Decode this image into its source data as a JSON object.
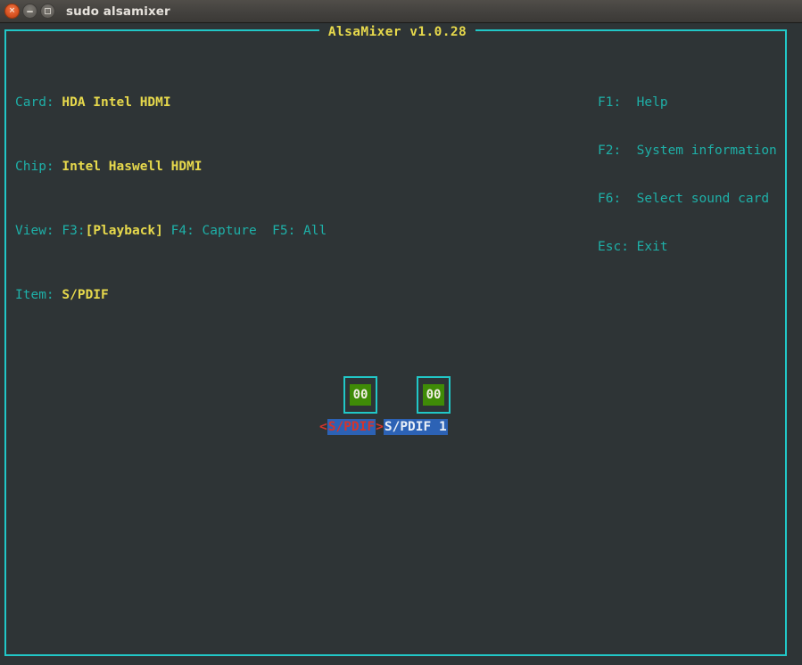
{
  "window": {
    "title": "sudo alsamixer",
    "buttons": {
      "close": "×",
      "minimize": "",
      "maximize": ""
    }
  },
  "app": {
    "frame_title": "AlsaMixer v1.0.28"
  },
  "header": {
    "card_label": "Card:",
    "card_value": "HDA Intel HDMI",
    "chip_label": "Chip:",
    "chip_value": "Intel Haswell HDMI",
    "view_label": "View:",
    "view_f3_key": "F3:",
    "view_f3_value": "[Playback]",
    "view_f4": "F4: Capture",
    "view_f5": "F5: All",
    "item_label": "Item:",
    "item_value": "S/PDIF"
  },
  "help": {
    "rows": [
      "F1:  Help",
      "F2:  System information",
      "F6:  Select sound card",
      "Esc: Exit"
    ]
  },
  "mixer": {
    "channels": [
      {
        "value": "00"
      },
      {
        "value": "00"
      }
    ],
    "left_arrow": "<",
    "right_arrow": ">",
    "active_control": "S/PDIF",
    "next_control": "S/PDIF 1"
  },
  "colors": {
    "terminal_bg": "#2e3436",
    "frame": "#21c7c7",
    "label_teal": "#1eb0a8",
    "value_yellow": "#e7d94c",
    "highlight_blue": "#2c62b5",
    "accent_red": "#d4342c",
    "meter_green": "#3f8b07"
  }
}
